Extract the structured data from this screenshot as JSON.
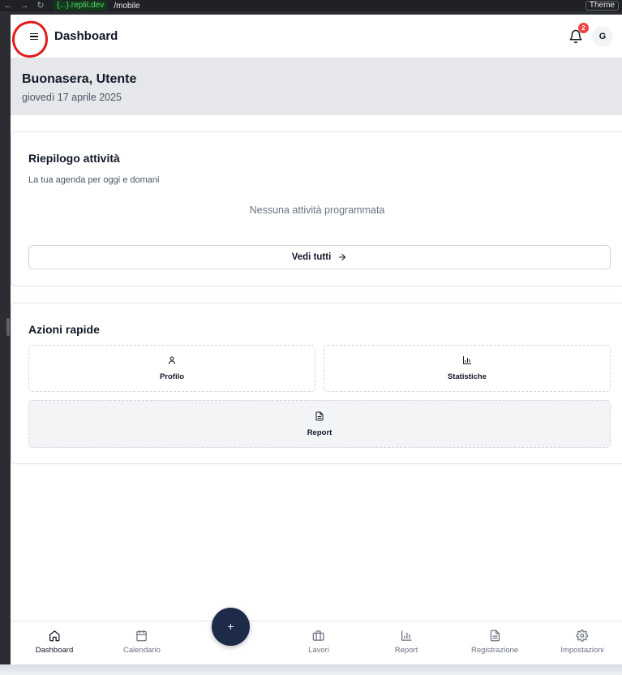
{
  "browser": {
    "host": "{...}.replit.dev",
    "path": "/mobile",
    "theme_label": "Theme"
  },
  "header": {
    "title": "Dashboard",
    "notification_count": "2",
    "avatar_initial": "G"
  },
  "greeting": {
    "title": "Buonasera, Utente",
    "date": "giovedì 17 aprile 2025"
  },
  "summary": {
    "title": "Riepilogo attività",
    "subtitle": "La tua agenda per oggi e domani",
    "empty_text": "Nessuna attività programmata",
    "see_all_label": "Vedi tutti"
  },
  "quick_actions": {
    "title": "Azioni rapide",
    "profile_label": "Profilo",
    "stats_label": "Statistiche",
    "report_label": "Report"
  },
  "fab_label": "+",
  "bottom_nav": {
    "dashboard": "Dashboard",
    "calendar": "Calendario",
    "jobs": "Lavori",
    "report": "Report",
    "registration": "Registrazione",
    "settings": "Impostazioni"
  },
  "colors": {
    "accent": "#1e2a4a",
    "badge": "#ef4444",
    "annotation_circle": "#e31b1b"
  }
}
